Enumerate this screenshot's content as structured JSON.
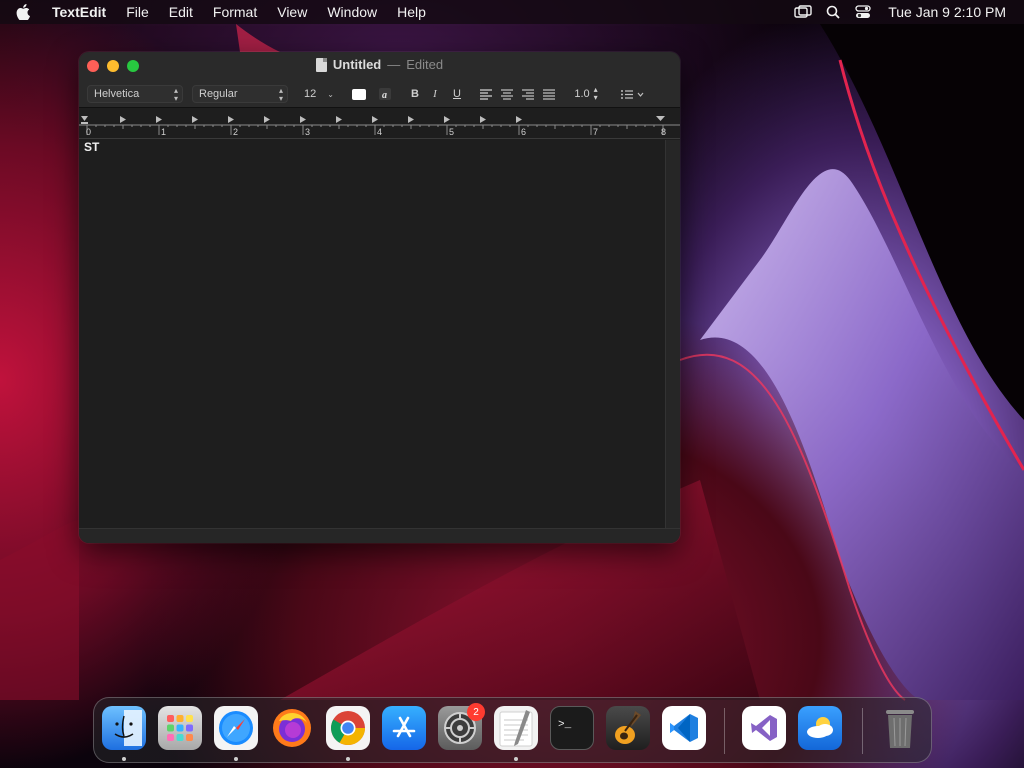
{
  "menubar": {
    "app_name": "TextEdit",
    "items": [
      "File",
      "Edit",
      "Format",
      "View",
      "Window",
      "Help"
    ],
    "clock": "Tue Jan 9  2:10 PM"
  },
  "window": {
    "title": "Untitled",
    "title_separator": "—",
    "status": "Edited",
    "toolbar": {
      "font_family": "Helvetica",
      "font_style": "Regular",
      "font_size": "12",
      "bold_label": "B",
      "italic_label": "I",
      "underline_label": "U",
      "line_spacing": "1.0"
    },
    "ruler_labels": [
      "0",
      "1",
      "2",
      "3",
      "4",
      "5",
      "6",
      "7",
      "8"
    ],
    "document_text": "ST"
  },
  "dock": {
    "badge_count": "2",
    "apps": [
      "Finder",
      "Launchpad",
      "Safari",
      "Firefox",
      "Chrome",
      "App Store",
      "System Settings",
      "TextEdit",
      "Terminal",
      "GarageBand",
      "Visual Studio Code",
      "Visual Studio",
      "Weather",
      "Trash"
    ]
  },
  "colors": {
    "close": "#fe5f57",
    "minimize": "#febc2e",
    "maximize": "#28c840",
    "window_bg": "#1e1e1e",
    "badge": "#ff3b30"
  }
}
